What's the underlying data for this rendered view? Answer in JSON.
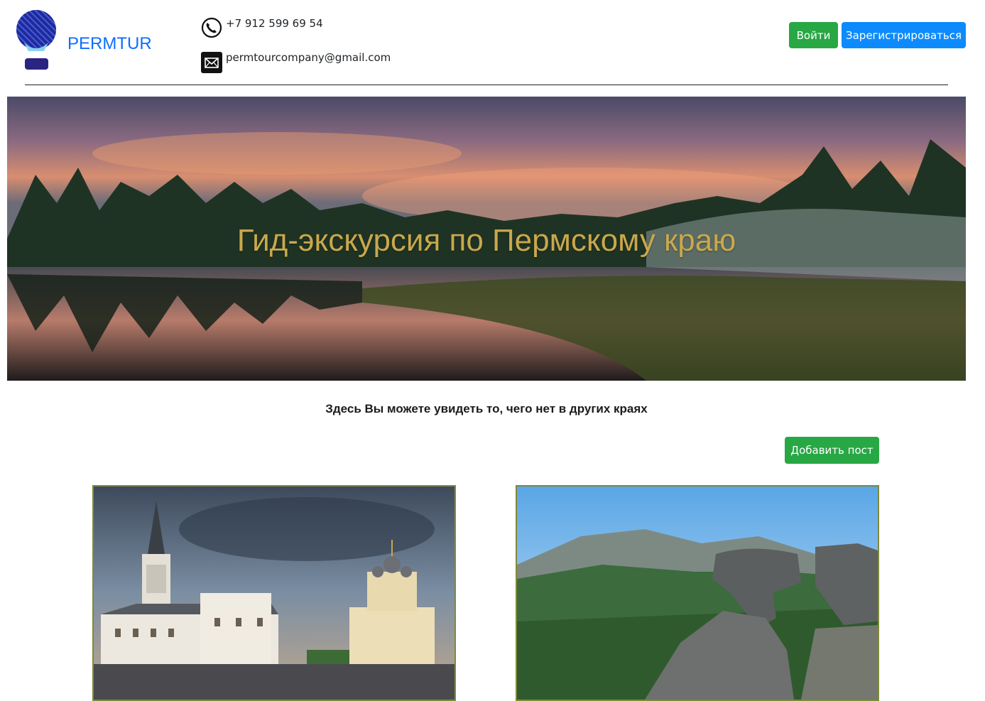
{
  "header": {
    "brand": "PERMTUR",
    "phone": "+7 912 599 69 54",
    "email": "permtourcompany@gmail.com",
    "login_label": "Войти",
    "register_label": "Зарегистрироваться"
  },
  "hero": {
    "title": "Гид-экскурсия по Пермскому краю"
  },
  "main": {
    "tagline": "Здесь Вы можете увидеть то, чего нет в других краях",
    "add_post_label": "Добавить пост"
  },
  "colors": {
    "brand": "#0d6efd",
    "success": "#28a745",
    "primary": "#0d8bfd",
    "hero_title": "#c9a84c",
    "card_border": "#7f8a3a"
  },
  "icons": [
    "logo-balloon-icon",
    "phone-icon",
    "mail-icon"
  ]
}
